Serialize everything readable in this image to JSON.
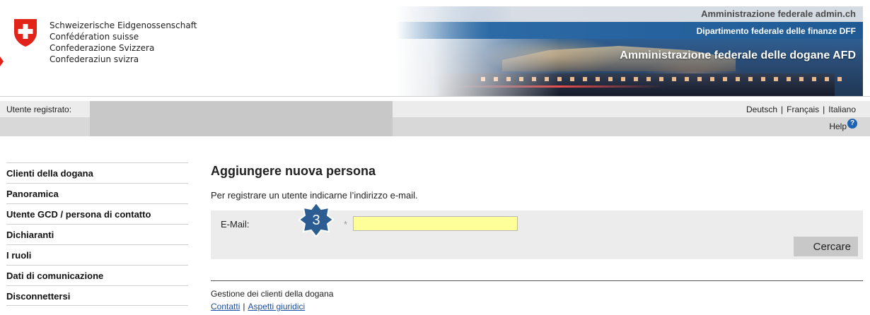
{
  "header": {
    "languages": [
      "Schweizerische Eidgenossenschaft",
      "Confédération suisse",
      "Confederazione Svizzera",
      "Confederaziun svizra"
    ],
    "admin_ch": "Amministrazione federale admin.ch",
    "department": "Dipartimento federale delle finanze DFF",
    "office": "Amministrazione federale delle dogane AFD",
    "logo_icon": "swiss-cross-icon",
    "colors": {
      "swiss_red": "#e2231a",
      "banner_blue": "#1f5a94"
    }
  },
  "userbar": {
    "label": "Utente registrato:",
    "languages": [
      "Deutsch",
      "Français",
      "Italiano"
    ],
    "separator": "|"
  },
  "toolbar": {
    "help_label": "Help",
    "help_icon": "help-question-icon"
  },
  "sidebar": {
    "items": [
      {
        "label": "Clienti della dogana"
      },
      {
        "label": "Panoramica"
      },
      {
        "label": "Utente GCD / persona di contatto"
      },
      {
        "label": "Dichiaranti"
      },
      {
        "label": "I ruoli"
      },
      {
        "label": "Dati di comunicazione"
      },
      {
        "label": "Disconnettersi"
      }
    ]
  },
  "main": {
    "title": "Aggiungere nuova persona",
    "intro": "Per registrare un utente indicarne l’indirizzo e-mail.",
    "form": {
      "email_label": "E-Mail:",
      "required_marker": "*",
      "email_value": "",
      "search_button": "Cercare"
    },
    "step_badge": "3"
  },
  "footer": {
    "title": "Gestione dei clienti della dogana",
    "links": [
      "Contatti",
      "Aspetti giuridici"
    ],
    "separator": "|"
  }
}
